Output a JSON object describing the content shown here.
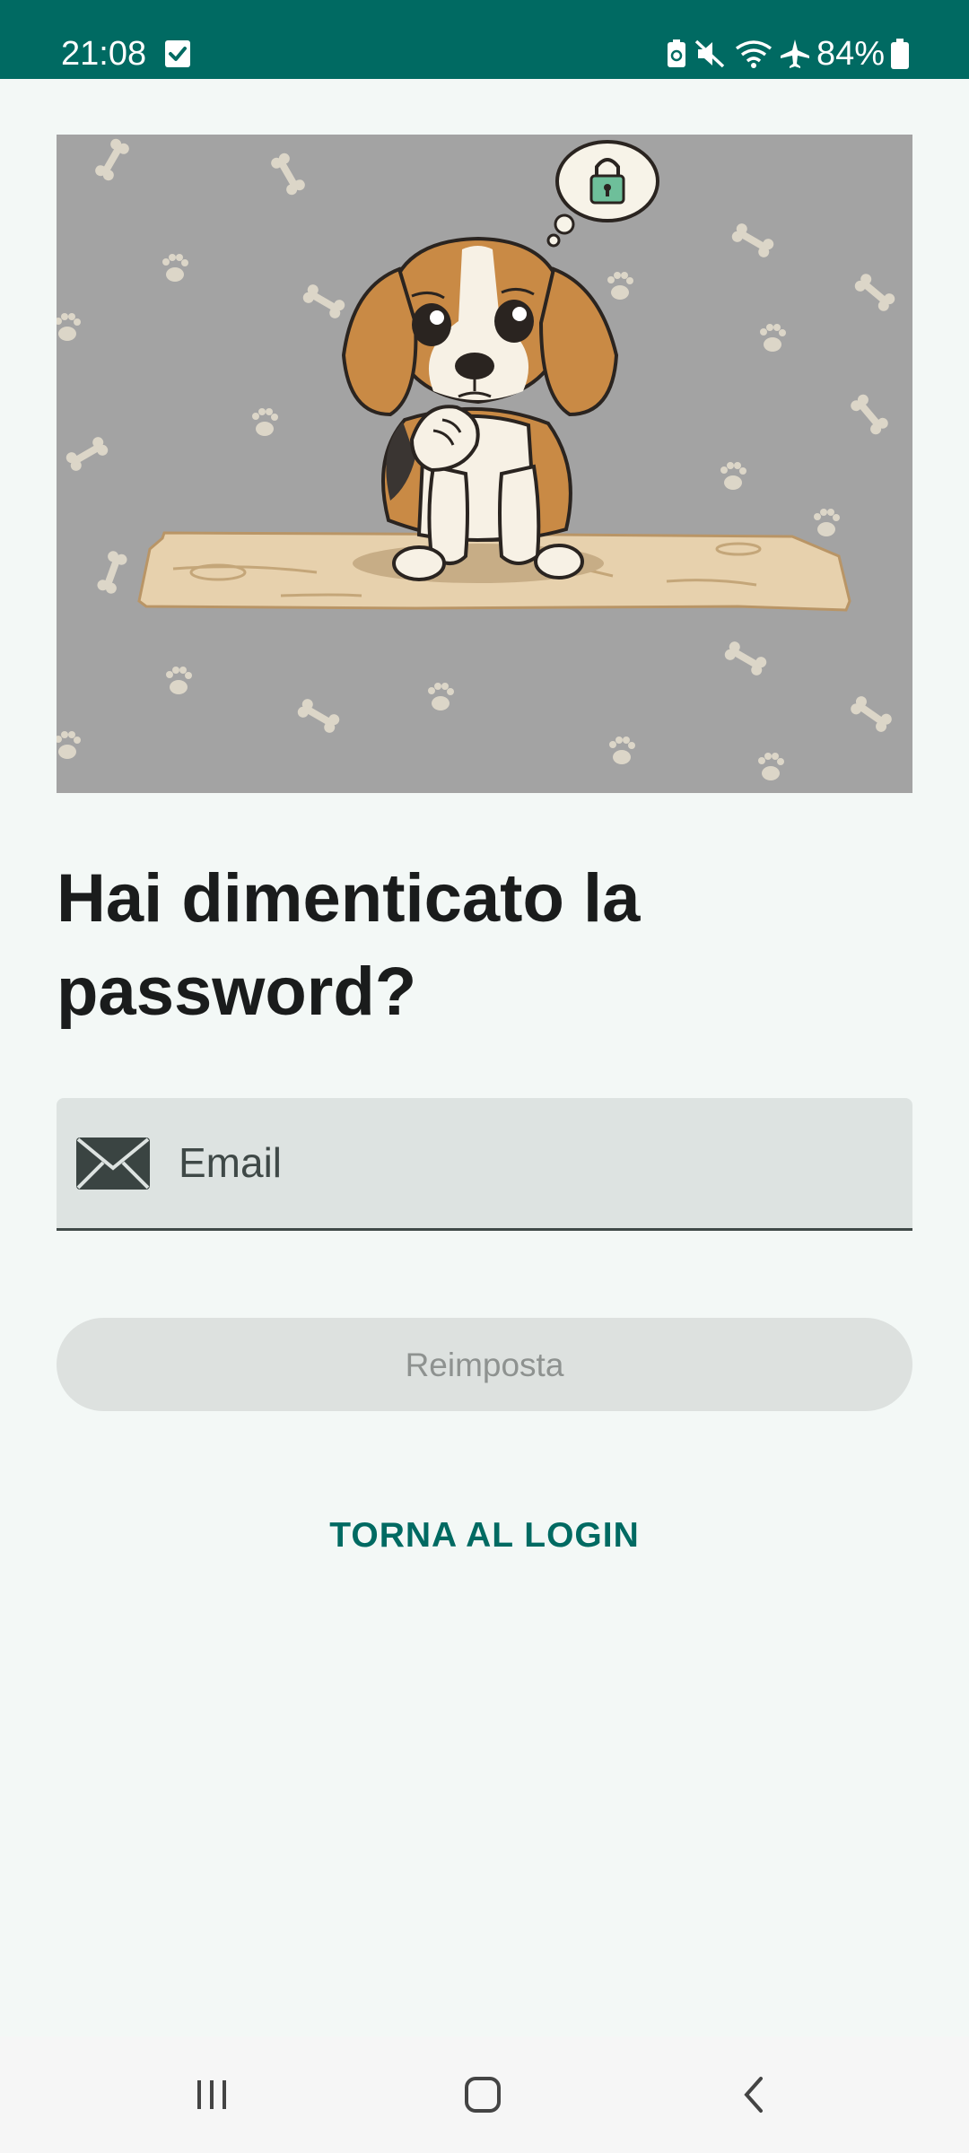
{
  "status_bar": {
    "time": "21:08",
    "battery_percent": "84%",
    "icons": [
      "check-notification-icon",
      "battery-saver-icon",
      "mute-icon",
      "wifi-icon",
      "airplane-icon",
      "battery-icon"
    ],
    "background_color": "#006a62"
  },
  "hero": {
    "icon": "thinking-beagle-illustration",
    "thought_icon": "lock-icon"
  },
  "page": {
    "title": "Hai dimenticato la password?"
  },
  "email_field": {
    "icon": "envelope-icon",
    "placeholder": "Email",
    "value": ""
  },
  "reset_button": {
    "label": "Reimposta",
    "enabled": false
  },
  "back_link": {
    "label": "TORNA AL LOGIN",
    "color": "#006a62"
  },
  "nav_bar": {
    "items": [
      "recent-apps-icon",
      "home-icon",
      "back-icon"
    ]
  }
}
